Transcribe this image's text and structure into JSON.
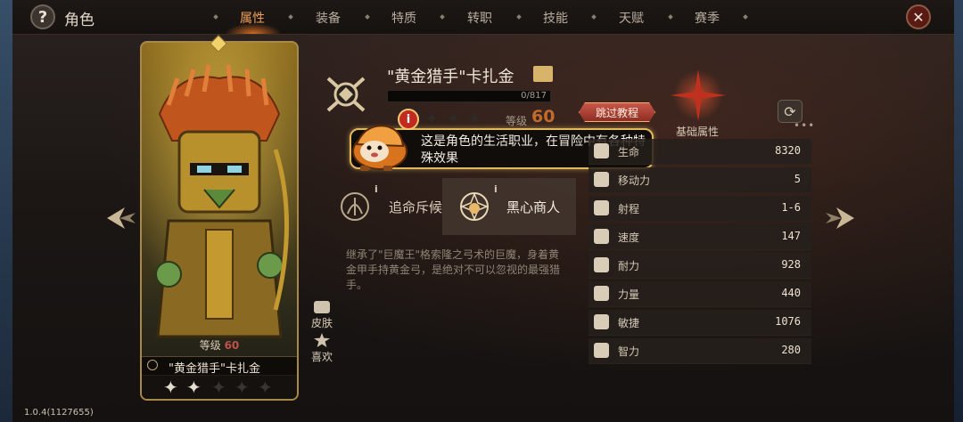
{
  "header": {
    "title": "角色",
    "tabs": [
      {
        "label": "属性",
        "active": true
      },
      {
        "label": "装备",
        "active": false
      },
      {
        "label": "特质",
        "active": false
      },
      {
        "label": "转职",
        "active": false
      },
      {
        "label": "技能",
        "active": false
      },
      {
        "label": "天赋",
        "active": false
      },
      {
        "label": "赛季",
        "active": false
      }
    ],
    "close_icon": "close-x"
  },
  "card": {
    "level_label": "等级",
    "level_value": "60",
    "name": "\"黄金猎手\"卡扎金",
    "stars_total": 5,
    "stars_filled": 2
  },
  "side_actions": {
    "skin": "皮肤",
    "like": "喜欢"
  },
  "hero": {
    "title": "\"黄金猎手\"卡扎金",
    "xp_text": "0/817",
    "stars_total": 3,
    "level_label": "等级",
    "level_value": "60"
  },
  "tooltip": {
    "text": "这是角色的生活职业，在冒险中有各种特殊效果",
    "info_badge": "i"
  },
  "tutorial": {
    "skip_label": "跳过教程"
  },
  "classes": [
    {
      "name": "追命斥候",
      "selected": false
    },
    {
      "name": "黑心商人",
      "selected": true
    }
  ],
  "description": "继承了\"巨魔王\"格索隆之弓术的巨魔，身着黄金甲手持黄金弓，是绝对不可以忽视的最强猎手。",
  "stats": {
    "title": "基础属性",
    "more": "•••",
    "rows": [
      {
        "label": "生命",
        "value": "8320",
        "icon": "heart-icon"
      },
      {
        "label": "移动力",
        "value": "5",
        "icon": "boot-icon"
      },
      {
        "label": "射程",
        "value": "1-6",
        "icon": "target-icon"
      },
      {
        "label": "速度",
        "value": "147",
        "icon": "speed-icon"
      },
      {
        "label": "耐力",
        "value": "928",
        "icon": "shield-icon"
      },
      {
        "label": "力量",
        "value": "440",
        "icon": "fist-icon"
      },
      {
        "label": "敏捷",
        "value": "1076",
        "icon": "agility-icon"
      },
      {
        "label": "智力",
        "value": "280",
        "icon": "brain-icon"
      }
    ]
  },
  "version": "1.0.4(1127655)",
  "colors": {
    "accent": "#f2a055",
    "level": "#c16a2e",
    "tooltip_border": "#e2b85c",
    "skip_button": "#c9564a"
  }
}
